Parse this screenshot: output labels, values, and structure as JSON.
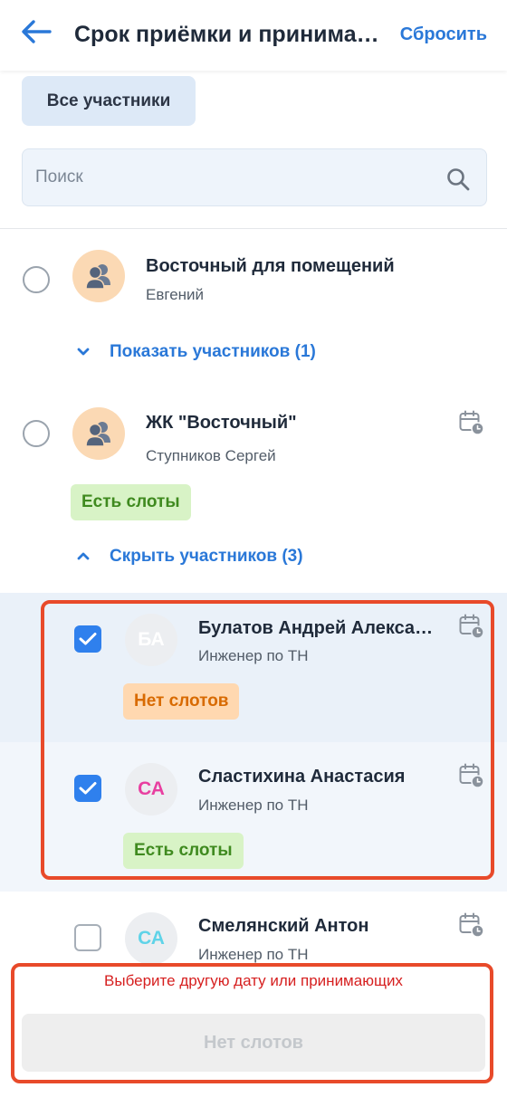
{
  "header": {
    "title": "Срок приёмки и принимающие",
    "reset_label": "Сбросить"
  },
  "filter": {
    "all_label": "Все участники"
  },
  "search": {
    "placeholder": "Поиск",
    "value": ""
  },
  "groups": [
    {
      "title": "Восточный для помещений",
      "subtitle": "Евгений",
      "selected": false,
      "toggle_label": "Показать участников (1)",
      "toggle_state": "collapsed"
    },
    {
      "title": "ЖК \"Восточный\"",
      "subtitle": "Ступников Сергей",
      "selected": false,
      "badge": "Есть слоты",
      "toggle_label": "Скрыть участников (3)",
      "toggle_state": "expanded"
    }
  ],
  "members": [
    {
      "initials": "БА",
      "initials_color": "#ffffff",
      "name": "Булатов Андрей Александрович",
      "role": "Инженер по ТН",
      "checked": true,
      "badge": "Нет слотов",
      "badge_type": "no-slots"
    },
    {
      "initials": "СА",
      "initials_color": "#e83fa0",
      "name": "Сластихина Анастасия",
      "role": "Инженер по ТН",
      "checked": true,
      "badge": "Есть слоты",
      "badge_type": "has-slots"
    },
    {
      "initials": "СА",
      "initials_color": "#5fd3e8",
      "name": "Смелянский Антон",
      "role": "Инженер по ТН",
      "checked": false
    }
  ],
  "footer": {
    "message": "Выберите другую дату или принимающих",
    "button_label": "Нет слотов"
  },
  "colors": {
    "accent": "#2a78d8",
    "checkbox": "#2f80ed",
    "error": "#d61f1f",
    "highlight_border": "#e84a2a"
  }
}
